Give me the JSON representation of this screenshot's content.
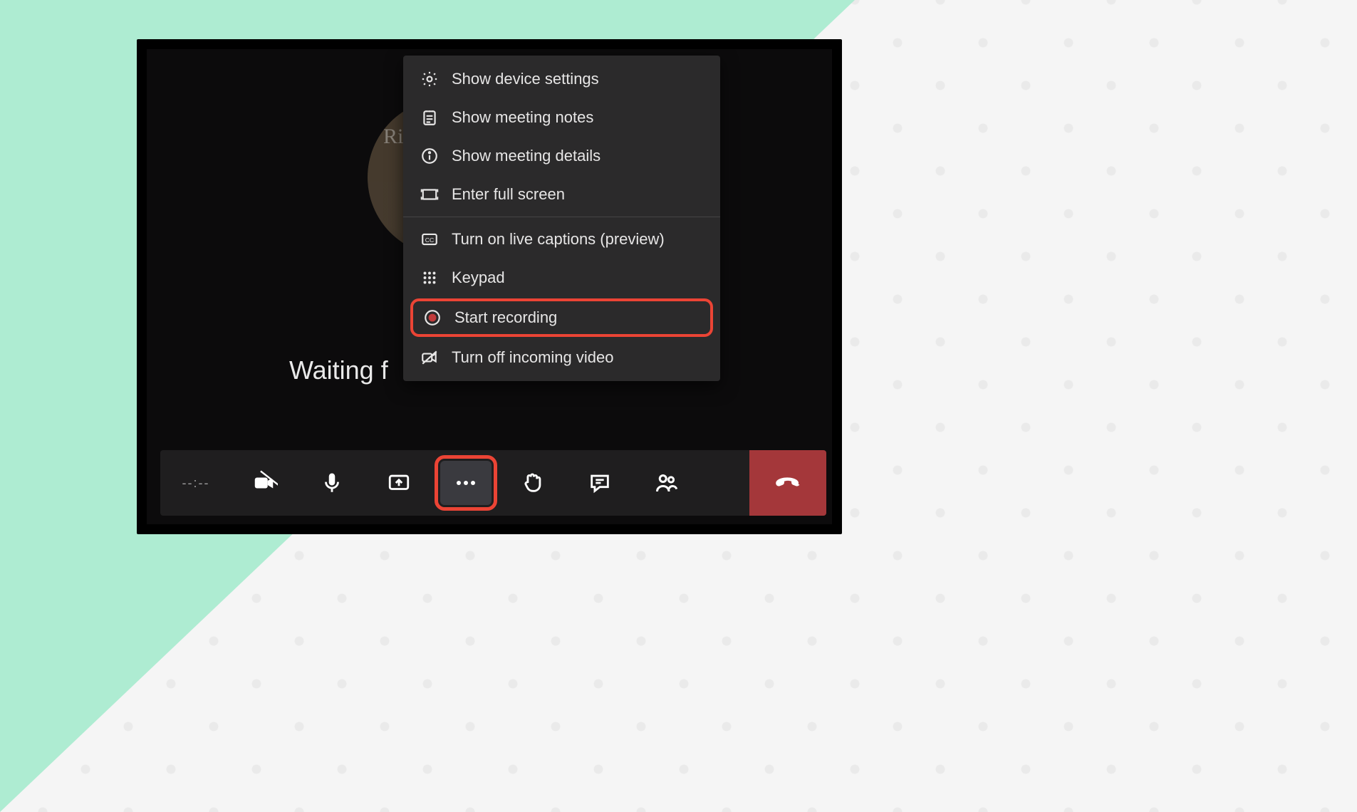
{
  "main": {
    "status_text": "Waiting f",
    "avatar_hint": "Rit\nCa"
  },
  "menu": {
    "items": [
      {
        "icon": "gear-icon",
        "label": "Show device settings"
      },
      {
        "icon": "notes-icon",
        "label": "Show meeting notes"
      },
      {
        "icon": "info-icon",
        "label": "Show meeting details"
      },
      {
        "icon": "fullscreen-icon",
        "label": "Enter full screen"
      }
    ],
    "items2": [
      {
        "icon": "cc-icon",
        "label": "Turn on live captions (preview)"
      },
      {
        "icon": "keypad-icon",
        "label": "Keypad"
      },
      {
        "icon": "record-icon",
        "label": "Start recording",
        "highlight": true
      },
      {
        "icon": "video-off-icon",
        "label": "Turn off incoming video"
      }
    ]
  },
  "toolbar": {
    "duration": "--:--",
    "buttons": {
      "camera": "Toggle camera",
      "mic": "Toggle microphone",
      "share": "Share screen",
      "more": "More actions",
      "raise_hand": "Raise hand",
      "chat": "Show conversation",
      "people": "Show participants",
      "hangup": "Hang up"
    }
  },
  "colors": {
    "accent_highlight": "#eb4435",
    "hangup": "#a4373a",
    "mint": "#aeecd2"
  }
}
